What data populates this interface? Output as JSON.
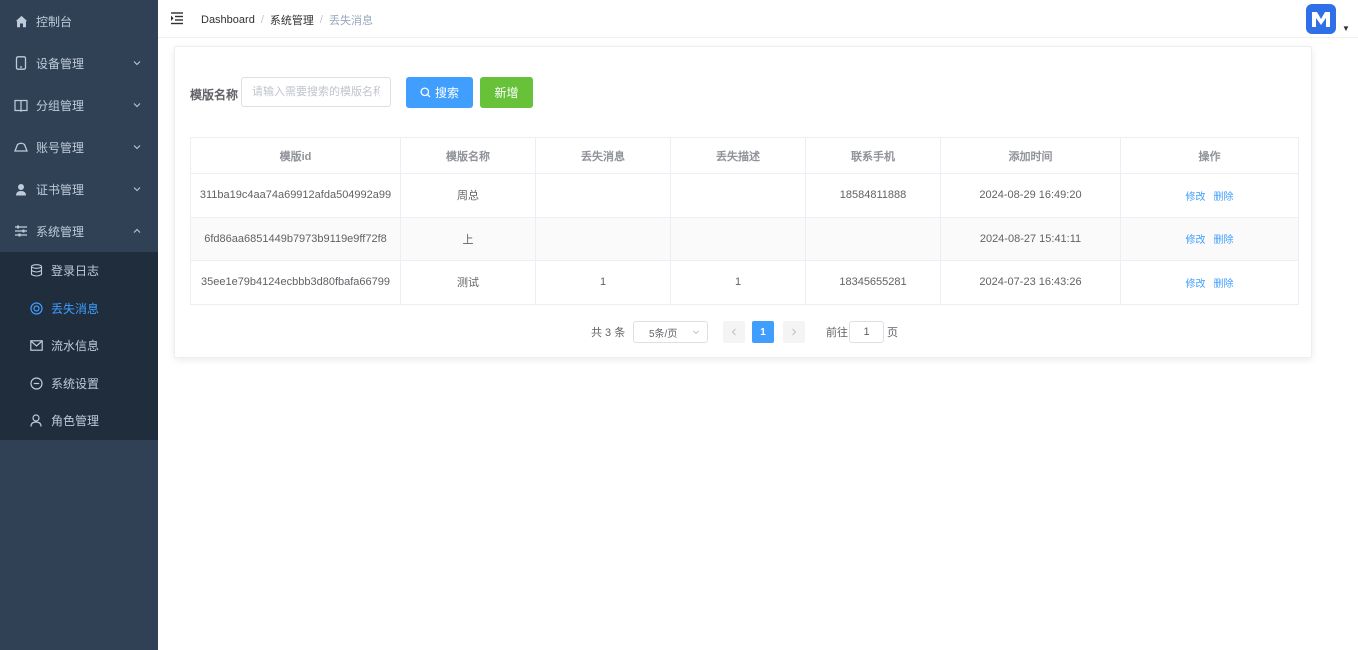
{
  "sidebar": {
    "items": [
      {
        "label": "控制台"
      },
      {
        "label": "设备管理"
      },
      {
        "label": "分组管理"
      },
      {
        "label": "账号管理"
      },
      {
        "label": "证书管理"
      },
      {
        "label": "系统管理"
      }
    ],
    "submenu": [
      {
        "label": "登录日志"
      },
      {
        "label": "丢失消息"
      },
      {
        "label": "流水信息"
      },
      {
        "label": "系统设置"
      },
      {
        "label": "角色管理"
      }
    ],
    "active_color": "#409eff"
  },
  "breadcrumb": {
    "home": "Dashboard",
    "section": "系统管理",
    "current": "丢失消息"
  },
  "search": {
    "label": "模版名称",
    "placeholder": "请输入需要搜索的模版名称",
    "search_button": "搜索",
    "add_button": "新增"
  },
  "table": {
    "headers": [
      "模版id",
      "模版名称",
      "丢失消息",
      "丢失描述",
      "联系手机",
      "添加时间",
      "操作"
    ],
    "rows": [
      {
        "id": "311ba19c4aa74a69912afda504992a99",
        "name": "周总",
        "lost_msg": "",
        "lost_desc": "",
        "phone": "18584811888",
        "time": "2024-08-29 16:49:20"
      },
      {
        "id": "6fd86aa6851449b7973b9119e9ff72f8",
        "name": "上",
        "lost_msg": "",
        "lost_desc": "",
        "phone": "",
        "time": "2024-08-27 15:41:11"
      },
      {
        "id": "35ee1e79b4124ecbbb3d80fbafa66799",
        "name": "测试",
        "lost_msg": "1",
        "lost_desc": "1",
        "phone": "18345655281",
        "time": "2024-07-23 16:43:26"
      }
    ],
    "edit_label": "修改",
    "delete_label": "删除"
  },
  "pagination": {
    "total": "共 3 条",
    "page_size": "5条/页",
    "current_page": "1",
    "goto_label": "前往",
    "goto_value": "1",
    "goto_suffix": "页"
  },
  "colors": {
    "sidebar_bg": "#304156",
    "primary": "#409eff",
    "success": "#67c23a"
  }
}
